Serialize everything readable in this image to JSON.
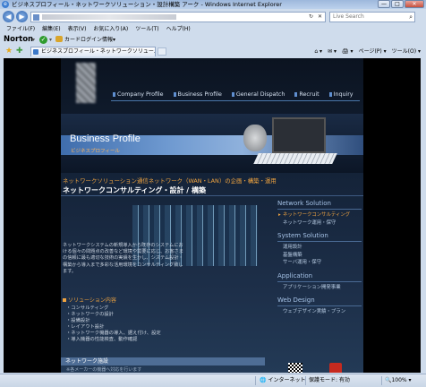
{
  "window": {
    "title": "ビジネスプロフィール・ネットワークソリューション・設計構築 アーク - Windows Internet Explorer",
    "min": "—",
    "max": "□",
    "close": "✕"
  },
  "address": {
    "refresh": "↻",
    "stop": "✕"
  },
  "search": {
    "placeholder": "Live Search",
    "icon": "search-icon"
  },
  "menu": [
    "ファイル(F)",
    "編集(E)",
    "表示(V)",
    "お気に入り(A)",
    "ツール(T)",
    "ヘルプ(H)"
  ],
  "norton": {
    "brand": "Norton",
    "caret": "▾",
    "check": "✓",
    "card_login": "カードログイン情報▾"
  },
  "tabs": {
    "active": "ビジネスプロフィール・ネットワークソリュー...",
    "tools": [
      "⌂ ▾",
      "✉ ▾",
      "🖨 ▾",
      "ページ(P) ▾",
      "ツール(O) ▾"
    ]
  },
  "site": {
    "nav": [
      "Company Profile",
      "Business Profile",
      "General Dispatch",
      "Recruit",
      "Inquiry"
    ],
    "banner": {
      "title": "Business Profile",
      "subtitle": "ビジネスプロフィール"
    },
    "heading_orange": "ネットワークソリューション通信ネットワーク（WAN・LAN）の企画・構築・運用",
    "heading_white": "ネットワークコンサルティング・設計 / 構築",
    "intro": "ネットワークシステムの新規導入から既存のシステムにおける個々の問題点の改善など環境や需要に応じ、お客さまの信頼に最も適切な技術の実績を生かし、システム設計・構築から導入まで多彩な活用環境をコンサルティング致します。",
    "section_title": "ソリューション内容",
    "section_items": [
      "・コンサルティング",
      "・ネットワークの設計",
      "・設備設計",
      "・レイアウト設計",
      "・ネットワーク機器の導入、据え付け、設定",
      "・導入機器の性能検査、動作確認"
    ],
    "netbar": "ネットワーク施設",
    "note": "※各メーカーの機器へ対応を行います",
    "sidebar": [
      {
        "title": "Network Solution",
        "items": [
          "ネットワークコンサルティング",
          "ネットワーク運用・保守"
        ],
        "active": 0
      },
      {
        "title": "System Solution",
        "items": [
          "運用設計",
          "基盤構築",
          "サーバ運用・保守"
        ],
        "active": -1
      },
      {
        "title": "Application",
        "items": [
          "アプリケーション開発事業"
        ],
        "active": -1
      },
      {
        "title": "Web Design",
        "items": [
          "ウェブデザイン実績・プラン"
        ],
        "active": -1
      }
    ]
  },
  "status": {
    "zone": "インターネット",
    "protected": "保護モード: 有効",
    "zoom": "🔍100% ▾"
  }
}
